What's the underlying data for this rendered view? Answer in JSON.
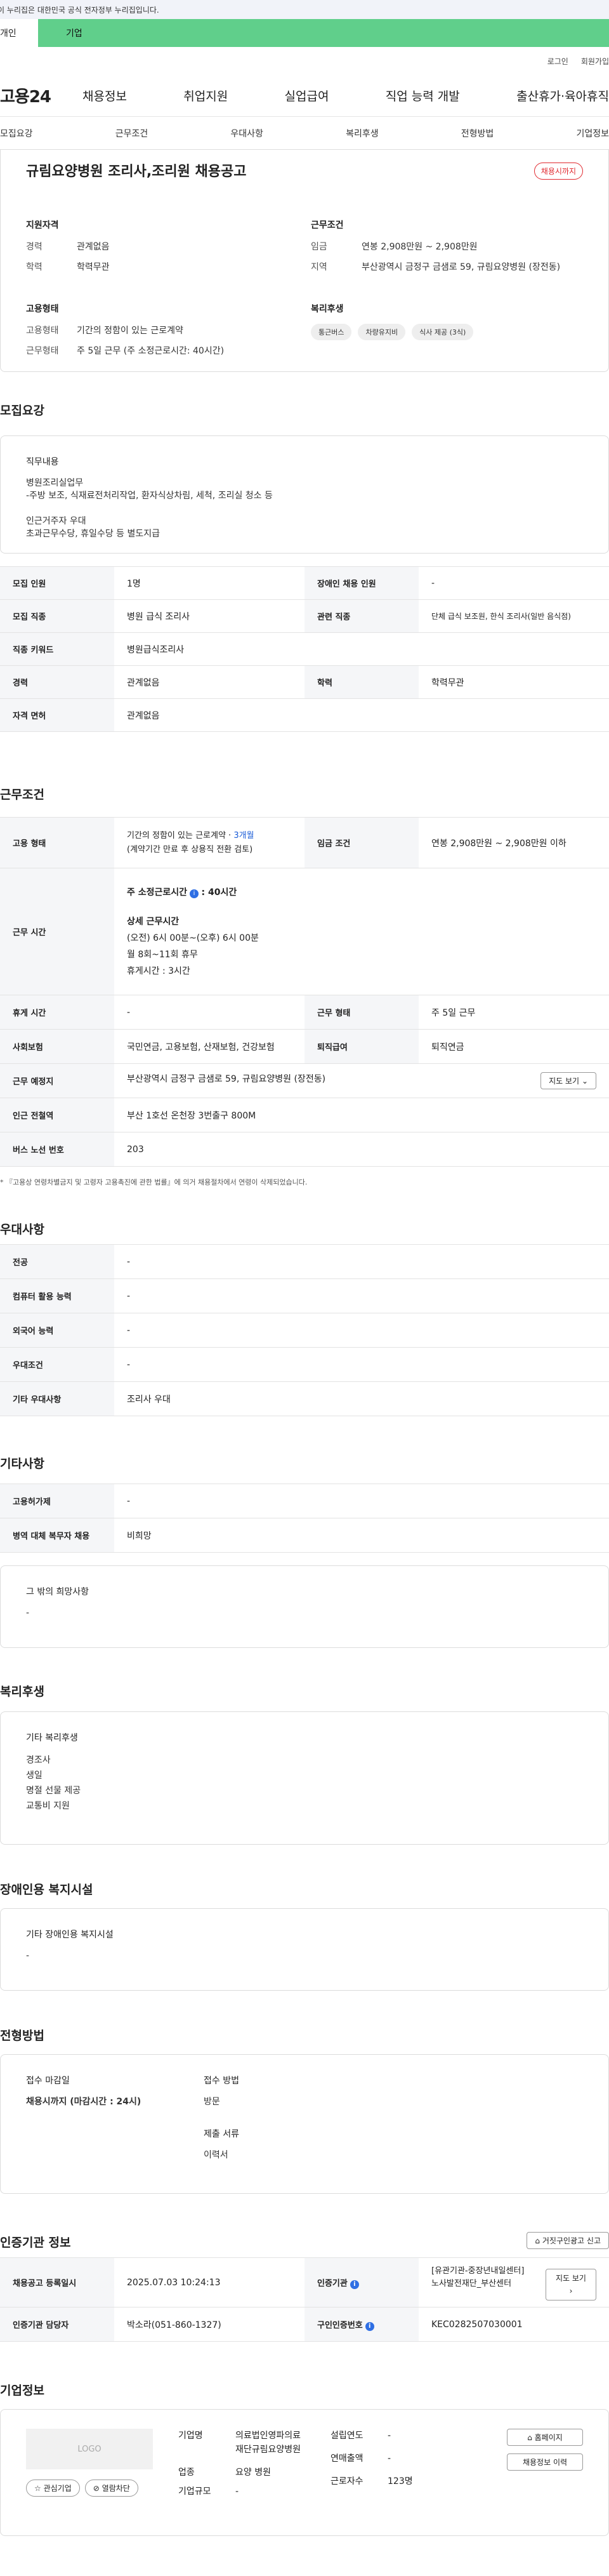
{
  "gov_banner": "이 누리집은 대한민국 공식 전자정부 누리집입니다.",
  "user_tabs": [
    "개인",
    "기업"
  ],
  "util": [
    "로그인",
    "회원가입"
  ],
  "logo": "고용24",
  "gnb": [
    "채용정보",
    "취업지원",
    "실업급여",
    "직업 능력 개발",
    "출산휴가·육아휴직"
  ],
  "subnav": [
    "모집요강",
    "근무조건",
    "우대사항",
    "복리후생",
    "전형방법",
    "기업정보"
  ],
  "header": {
    "title": "규림요양병원 조리사,조리원 채용공고",
    "badge": "채용시까지",
    "qual_title": "지원자격",
    "career_k": "경력",
    "career_v": "관계없음",
    "edu_k": "학력",
    "edu_v": "학력무관",
    "emp_title": "고용형태",
    "emp_k": "고용형태",
    "emp_v": "기간의 정함이 있는 근로계약",
    "work_k": "근무형태",
    "work_v": "주 5일 근무 (주 소정근로시간: 40시간)",
    "cond_title": "근무조건",
    "wage_k": "임금",
    "wage_v": "연봉 2,908만원 ~ 2,908만원",
    "area_k": "지역",
    "area_v": "부산광역시 금정구 금샘로 59, 규림요양병원 (장전동)",
    "welfare_title": "복리후생",
    "chips": [
      "통근버스",
      "차량유지비",
      "식사 제공 (3식)"
    ]
  },
  "recruit": {
    "title": "모집요강",
    "duty_title": "직무내용",
    "duty_lines": [
      "병원조리실업무",
      "-주방 보조, 식재료전처리작업, 환자식상차림, 세척, 조리실 청소 등",
      "",
      "인근거주자 우대",
      "초과근무수당, 휴일수당 등 별도지급"
    ],
    "rows": [
      {
        "k1": "모집 인원",
        "v1": "1명",
        "k2": "장애인 채용 인원",
        "v2": "-"
      },
      {
        "k1": "모집 직종",
        "v1": "병원 급식 조리사",
        "k2": "관련 직종",
        "v2": "단체 급식 보조원, 한식 조리사(일반 음식점)"
      },
      {
        "k1": "직종 키워드",
        "v1": "병원급식조리사",
        "k2": "",
        "v2": ""
      },
      {
        "k1": "경력",
        "v1": "관계없음",
        "k2": "학력",
        "v2": "학력무관"
      },
      {
        "k1": "자격 면허",
        "v1": "관계없음",
        "k2": "",
        "v2": ""
      }
    ]
  },
  "conditions": {
    "title": "근무조건",
    "emp_k": "고용 형태",
    "emp_v1": "기간의 정함이 있는 근로계약 · ",
    "emp_v1_blue": "3개월",
    "emp_v2": "(계약기간 만료 후 상용직 전환 검토)",
    "wage_k": "임금 조건",
    "wage_v": "연봉 2,908만원 ~ 2,908만원 이하",
    "hours_k": "근무 시간",
    "hours_label": "주 소정근로시간",
    "hours_value": ": 40시간",
    "detail_title": "상세 근무시간",
    "detail_lines": [
      "(오전) 6시 00분~(오후) 6시 00분",
      "월 8회~11회 휴무",
      "휴게시간 : 3시간"
    ],
    "break_k": "휴게 시간",
    "break_v": "-",
    "form_k": "근무 형태",
    "form_v": "주 5일 근무",
    "ins_k": "사회보험",
    "ins_v": "국민연금, 고용보험, 산재보험, 건강보험",
    "ret_k": "퇴직급여",
    "ret_v": "퇴직연금",
    "place_k": "근무 예정지",
    "place_v": "부산광역시 금정구 금샘로 59, 규림요양병원 (장전동)",
    "map_btn": "지도 보기",
    "sub_k": "인근 전철역",
    "sub_v": "부산 1호선 온천장 3번출구 800M",
    "bus_k": "버스 노선 번호",
    "bus_v": "203",
    "note": "* 『고용상 연령차별금지 및 고령자 고용촉진에 관한 법률』에 의거 채용절차에서 연령이 삭제되었습니다."
  },
  "pref": {
    "title": "우대사항",
    "rows": [
      {
        "k": "전공",
        "v": "-"
      },
      {
        "k": "컴퓨터 활용 능력",
        "v": "-"
      },
      {
        "k": "외국어 능력",
        "v": "-"
      },
      {
        "k": "우대조건",
        "v": "-"
      },
      {
        "k": "기타 우대사항",
        "v": "조리사 우대"
      }
    ]
  },
  "etc": {
    "title": "기타사항",
    "rows": [
      {
        "k": "고용허가제",
        "v": "-"
      },
      {
        "k": "병역 대체 복무자 채용",
        "v": "비희망"
      }
    ],
    "wish_title": "그 밖의 희망사항",
    "wish_v": "-"
  },
  "welfare": {
    "title": "복리후생",
    "box_title": "기타 복리후생",
    "lines": [
      "경조사",
      "생일",
      "명절 선물 제공",
      "교통비 지원"
    ]
  },
  "disabled": {
    "title": "장애인용 복지시설",
    "box_title": "기타 장애인용 복지시설",
    "v": "-"
  },
  "selection": {
    "title": "전형방법",
    "deadline_title": "접수 마감일",
    "deadline_v": "채용시까지 (마감시간 : 24시)",
    "method_title": "접수 방법",
    "method_v": "방문",
    "docs_title": "제출 서류",
    "docs_v": "이력서"
  },
  "cert": {
    "title": "인증기관 정보",
    "report_btn": "거짓구인광고 신고",
    "reg_k": "채용공고 등록일시",
    "reg_v": "2025.07.03 10:24:13",
    "org_k": "인증기관",
    "org_v1": "[유관기관-중장년내일센터]",
    "org_v2": "노사발전재단_부산센터",
    "map_btn": "지도 보기",
    "mgr_k": "인증기관 담당자",
    "mgr_v": "박소라(051-860-1327)",
    "id_k": "구인인증번호",
    "id_v": "KEC0282507030001"
  },
  "company": {
    "title": "기업정보",
    "logo_text": "LOGO",
    "fav_btn": "관심기업",
    "block_btn": "열람차단",
    "name_k": "기업명",
    "name_v1": "의료법인영파의료",
    "name_v2": "재단규림요양병원",
    "ind_k": "업종",
    "ind_v": "요양 병원",
    "size_k": "기업규모",
    "size_v": "-",
    "year_k": "설립연도",
    "year_v": "-",
    "sales_k": "연매출액",
    "sales_v": "-",
    "emp_k": "근로자수",
    "emp_v": "123명",
    "home_btn": "홈페이지",
    "info_btn": "채용정보 이력"
  }
}
